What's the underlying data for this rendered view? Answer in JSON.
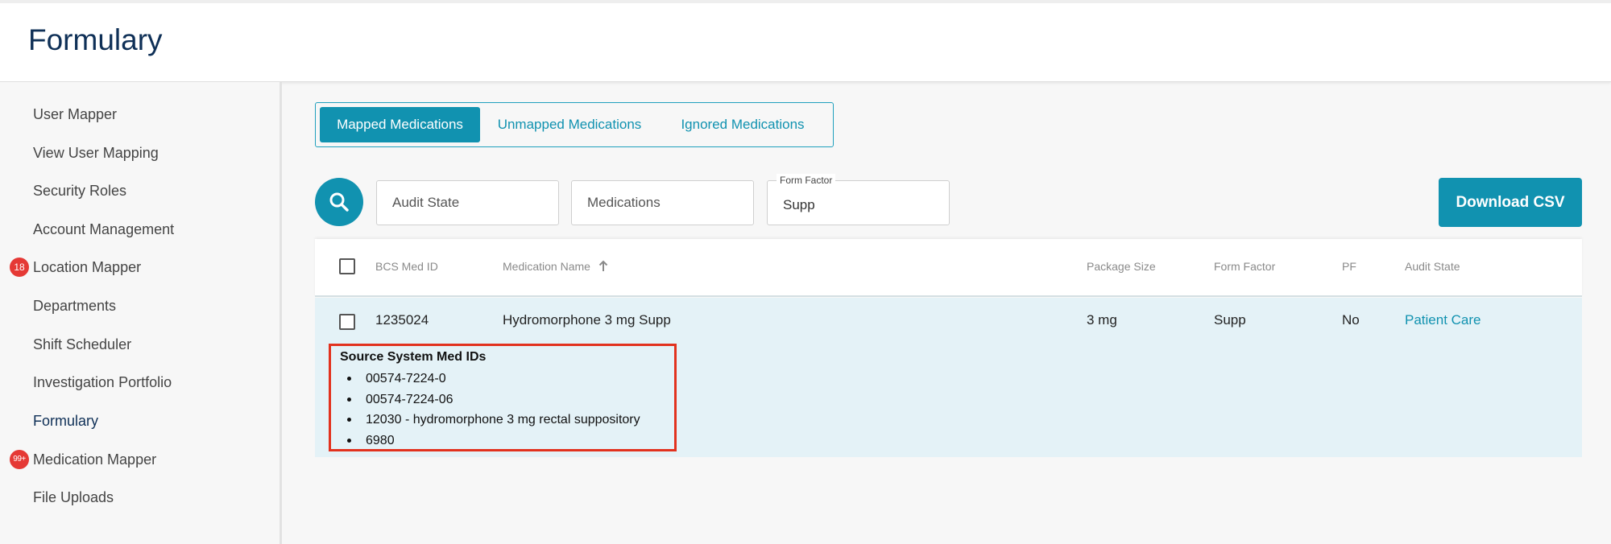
{
  "header": {
    "title": "Formulary"
  },
  "sidebar": {
    "items": [
      {
        "label": "User Mapper",
        "badge": null
      },
      {
        "label": "View User Mapping",
        "badge": null
      },
      {
        "label": "Security Roles",
        "badge": null
      },
      {
        "label": "Account Management",
        "badge": null
      },
      {
        "label": "Location Mapper",
        "badge": "18"
      },
      {
        "label": "Departments",
        "badge": null
      },
      {
        "label": "Shift Scheduler",
        "badge": null
      },
      {
        "label": "Investigation Portfolio",
        "badge": null
      },
      {
        "label": "Formulary",
        "badge": null,
        "active": true
      },
      {
        "label": "Medication Mapper",
        "badge": "99+"
      },
      {
        "label": "File Uploads",
        "badge": null
      }
    ]
  },
  "tabs": [
    {
      "label": "Mapped Medications",
      "active": true
    },
    {
      "label": "Unmapped Medications",
      "active": false
    },
    {
      "label": "Ignored Medications",
      "active": false
    }
  ],
  "filters": {
    "search_icon": "search-icon",
    "audit_state": {
      "placeholder": "Audit State",
      "value": ""
    },
    "medications": {
      "placeholder": "Medications",
      "value": ""
    },
    "form_factor": {
      "label": "Form Factor",
      "value": "Supp"
    }
  },
  "download_label": "Download CSV",
  "table": {
    "columns": {
      "bcs_med_id": "BCS Med ID",
      "medication_name": "Medication Name",
      "package_size": "Package Size",
      "form_factor": "Form Factor",
      "pf": "PF",
      "audit_state": "Audit State"
    },
    "sort": {
      "column": "Medication Name",
      "direction": "ascending",
      "icon": "arrow-up-icon"
    },
    "rows": [
      {
        "bcs_med_id": "1235024",
        "medication_name": "Hydromorphone 3 mg Supp",
        "package_size": "3 mg",
        "form_factor": "Supp",
        "pf": "No",
        "audit_state": "Patient Care",
        "source_title": "Source System Med IDs",
        "source_ids": [
          "00574-7224-0",
          "00574-7224-06",
          "12030 - hydromorphone 3 mg rectal suppository",
          "6980"
        ]
      }
    ]
  },
  "colors": {
    "brand_navy": "#0f3057",
    "accent_teal": "#1192b0",
    "badge_red": "#e53935",
    "highlight_box": "#e2321e",
    "expanded_row_bg": "#e4f2f7"
  }
}
